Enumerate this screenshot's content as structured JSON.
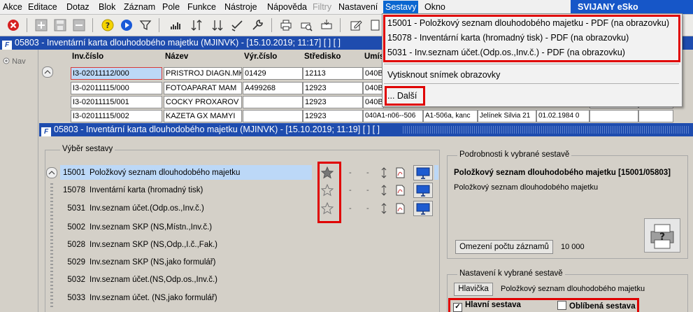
{
  "menubar": {
    "items": [
      "Akce",
      "Editace",
      "Dotaz",
      "Blok",
      "Záznam",
      "Pole",
      "Funkce",
      "Nástroje",
      "Nápověda",
      "Filtry",
      "Nastavení",
      "Sestavy",
      "Okno"
    ],
    "brand": "SVIJANY eSko"
  },
  "top_window": {
    "title": "05803 - Inventární karta dlouhodobého majetku (MJINVK) - [15.10.2019; 11:17]  [ ]  [ ]",
    "nav_label": "Nav",
    "columns": [
      "Inv.číslo",
      "Název",
      "Výr.číslo",
      "Středisko",
      "Umís"
    ],
    "rows": [
      [
        "I3-02011112/000",
        "PRISTROJ DIAGN.MK",
        "01429",
        "12113",
        "040B"
      ],
      [
        "I3-02011115/000",
        "FOTOAPARAT MAM",
        "A499268",
        "12923",
        "040B"
      ],
      [
        "I3-02011115/001",
        "COCKY PROXAROV",
        "",
        "12923",
        "040B"
      ],
      [
        "I3-02011115/002",
        "KAZETA GX MAMYI",
        "",
        "12923",
        "040A1-n06--506"
      ]
    ],
    "row4_extra": [
      "A1-506a, kanc",
      "Jelínek Silvia 21",
      "01.02.1984 0"
    ]
  },
  "sestavy_menu": {
    "items": [
      "15001 - Položkový seznam dlouhodobého majetku - PDF (na obrazovku)",
      "15078 - Inventární karta (hromadný tisk) - PDF (na obrazovku)",
      "5031 - Inv.seznam účet.(Odp.os.,Inv.č.) - PDF (na obrazovku)"
    ],
    "snapshot": "Vytisknout snímek obrazovky",
    "more": "... Další"
  },
  "report_window": {
    "title": "05803 - Inventární karta dlouhodobého majetku (MJINVK) - [15.10.2019; 11:19]  [ ]  [ ]",
    "selection_label": "Výběr sestavy",
    "reports": [
      {
        "code": "15001",
        "name": "Položkový seznam dlouhodobého majetku",
        "favorite": true
      },
      {
        "code": "15078",
        "name": "Inventární karta (hromadný tisk)",
        "favorite": false
      },
      {
        "code": "5031",
        "name": "Inv.seznam účet.(Odp.os.,Inv.č.)",
        "favorite": false
      },
      {
        "code": "5002",
        "name": "Inv.seznam SKP (NS,Místn.,Inv.č.)"
      },
      {
        "code": "5028",
        "name": "Inv.seznam SKP (NS,Odp.,I.č.,Fak.)"
      },
      {
        "code": "5029",
        "name": "Inv.seznam SKP (NS,jako formulář)"
      },
      {
        "code": "5032",
        "name": "Inv.seznam účet.(NS,Odp.os.,Inv.č.)"
      },
      {
        "code": "5033",
        "name": "Inv.seznam účet. (NS,jako formulář)"
      }
    ],
    "dash": "-",
    "details": {
      "label": "Podrobnosti k vybrané sestavě",
      "title": "Položkový seznam dlouhodobého majetku [15001/05803]",
      "subtitle": "Položkový seznam dlouhodobého majetku",
      "limit_button": "Omezení počtu záznamů",
      "limit_value": "10 000"
    },
    "settings": {
      "label": "Nastavení k vybrané sestavě",
      "header_button": "Hlavička",
      "header_value": "Položkový seznam dlouhodobého majetku",
      "main_report": "Hlavní sestava",
      "main_checked": true,
      "favorite_report": "Oblíbená sestava",
      "favorite_checked": false
    }
  },
  "colors": {
    "title_bar": "#1e4cae",
    "highlight": "#bcd8f7",
    "accent_red": "#e00000",
    "monitor_blue": "#1e5bd0"
  }
}
